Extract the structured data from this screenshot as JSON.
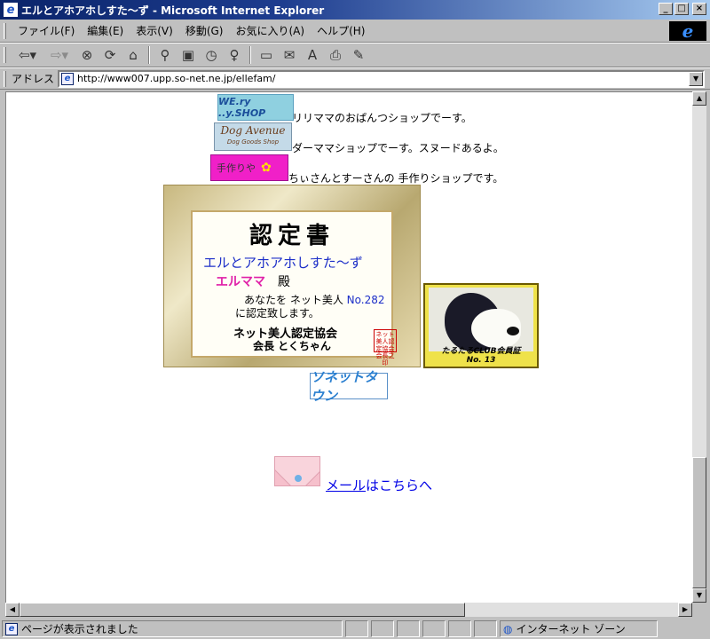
{
  "window": {
    "title": "エルとアホアホしすた～ず - Microsoft Internet Explorer"
  },
  "menu": [
    "ファイル(F)",
    "編集(E)",
    "表示(V)",
    "移動(G)",
    "お気に入り(A)",
    "ヘルプ(H)"
  ],
  "address": {
    "label": "アドレス",
    "url": "http://www007.upp.so-net.ne.jp/ellefam/"
  },
  "content": {
    "banners": [
      {
        "label": "WE.ry ..y.SHOP",
        "text": "リリママのおぱんつショップでーす。"
      },
      {
        "label": "Dog Avenue",
        "sublabel": "Dog Goods Shop",
        "text": "ダーママショップでーす。スヌードあるよ。"
      },
      {
        "label": "手作りや",
        "text": "ちぃさんとすーさんの 手作りショップです。"
      }
    ],
    "certificate": {
      "title": "認定書",
      "site": "エルとアホアホしすた～ず",
      "name": "エルママ",
      "honorific": "殿",
      "line1_prefix": "あなたを ネット美人",
      "number": "No.282",
      "line2": "に認定致します。",
      "association": "ネット美人認定協会",
      "chair": "会長 とくちゃん",
      "seal": "ネット美人認定協会会長之印"
    },
    "club_card": {
      "line1": "たるたるCLUB会員証",
      "line2": "No. 13"
    },
    "sonet": "ソネットタウン",
    "mail": {
      "link": "メール",
      "suffix": "はこちらへ"
    }
  },
  "status": {
    "left": "ページが表示されました",
    "zone": "インターネット ゾーン"
  }
}
